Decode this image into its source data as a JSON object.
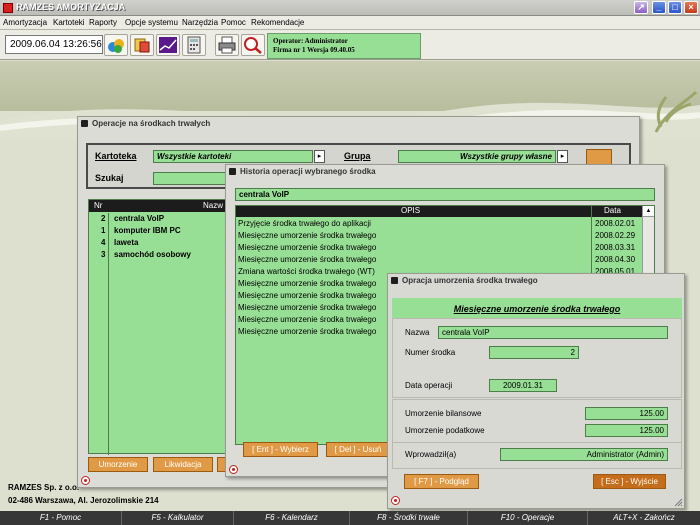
{
  "titlebar": {
    "title": "RAMZES AMORTYZACJA"
  },
  "menu": [
    "Amortyzacja",
    "Kartoteki",
    "Raporty",
    "Opcje systemu",
    "Narzędzia",
    "Pomoc",
    "Rekomendacje"
  ],
  "toolbar": {
    "datetime": "2009.06.04 13:26:56",
    "operator_line1": "Operator: Administrator",
    "operator_line2": "Firma nr 1   Wersja 09.40.05"
  },
  "operacje": {
    "title": "Operacje na środkach trwałych",
    "kartoteka_label": "Kartoteka",
    "kartoteka_value": "Wszystkie kartoteki",
    "grupa_label": "Grupa",
    "grupa_value": "Wszystkie grupy własne",
    "szukaj_label": "Szukaj",
    "col_nr": "Nr",
    "col_nazwa": "Nazw",
    "items": [
      {
        "nr": "2",
        "name": "centrala VoIP"
      },
      {
        "nr": "1",
        "name": "komputer IBM PC"
      },
      {
        "nr": "4",
        "name": "laweta"
      },
      {
        "nr": "3",
        "name": "samochód osobowy"
      }
    ],
    "btn_umorzenie": "Umorzenie",
    "btn_likwidacja": "Likwidacja"
  },
  "historia": {
    "title": "Historia operacji wybranego środka",
    "asset": "centrala VoIP",
    "col_opis": "OPIS",
    "col_data": "Data",
    "rows": [
      {
        "opis": "Przyjęcie środka trwałego do aplikacji",
        "data": "2008.02.01"
      },
      {
        "opis": "Miesięczne umorzenie środka trwałego",
        "data": "2008.02.29"
      },
      {
        "opis": "Miesięczne umorzenie środka trwałego",
        "data": "2008.03.31"
      },
      {
        "opis": "Miesięczne umorzenie środka trwałego",
        "data": "2008.04.30"
      },
      {
        "opis": "Zmiana wartości środka trwałego (WT)",
        "data": "2008.05.01"
      },
      {
        "opis": "Miesięczne umorzenie środka trwałego",
        "data": ""
      },
      {
        "opis": "Miesięczne umorzenie środka trwałego",
        "data": ""
      },
      {
        "opis": "Miesięczne umorzenie środka trwałego",
        "data": ""
      },
      {
        "opis": "Miesięczne umorzenie środka trwałego",
        "data": ""
      },
      {
        "opis": "Miesięczne umorzenie środka trwałego",
        "data": ""
      }
    ],
    "btn_wybierz": "[ Ent ] - Wybierz",
    "btn_usun": "[ Del ] - Usuń"
  },
  "umorzenie": {
    "title": "Opracja umorzenia środka trwałego",
    "heading": "Miesięczne umorzenie środka trwałego",
    "nazwa_label": "Nazwa",
    "nazwa_value": "centrala VoIP",
    "numer_label": "Numer środka",
    "numer_value": "2",
    "data_label": "Data operacji",
    "data_value": "2009.01.31",
    "bil_label": "Umorzenie bilansowe",
    "bil_value": "125.00",
    "pod_label": "Umorzenie podatkowe",
    "pod_value": "125.00",
    "wpr_label": "Wprowadził(a)",
    "wpr_value": "Administrator (Admin)",
    "btn_podglad": "[ F7 ] - Podgląd",
    "btn_wyjscie": "[ Esc ] - Wyjście"
  },
  "company": {
    "line1": "RAMZES Sp. z o.o.",
    "line2": "02-486 Warszawa, Al. Jerozolimskie 214"
  },
  "fkeys": [
    "F1 - Pomoc",
    "F5 - Kalkulator",
    "F6 - Kalendarz",
    "F8 - Środki trwałe",
    "F10 - Operacje",
    "ALT+X - Zakończ"
  ],
  "colors": {
    "field_green": "#98df96",
    "button_orange": "#e09a46",
    "list_green": "#98df96"
  }
}
